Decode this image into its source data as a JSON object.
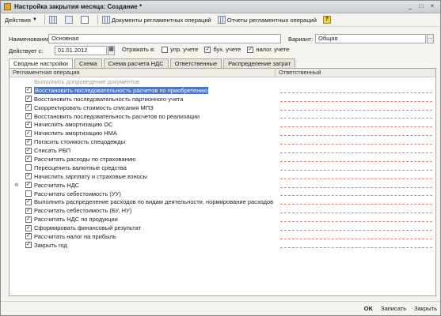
{
  "window": {
    "title": "Настройка закрытия месяца: Создание *",
    "controls": [
      "_",
      "□",
      "×"
    ]
  },
  "toolbar": {
    "actions_label": "Действия",
    "doc_reg_label": "Документы регламентных операций",
    "reports_label": "Отчеты регламентных операций"
  },
  "form": {
    "name_label": "Наименование:",
    "name_value": "Основная",
    "variant_label": "Вариант:",
    "variant_value": "Общая",
    "valid_from_label": "Действует с:",
    "valid_from_value": "01.01.2012",
    "reflect_label": "Отражать в:",
    "upr_label": "упр. учете",
    "upr_checked": false,
    "buh_label": "бух. учете",
    "buh_checked": true,
    "nal_label": "налог. учете",
    "nal_checked": true
  },
  "tabs": [
    {
      "label": "Сводные настройки",
      "active": true
    },
    {
      "label": "Схема",
      "active": false
    },
    {
      "label": "Схема расчета НДС",
      "active": false
    },
    {
      "label": "Ответственные",
      "active": false
    },
    {
      "label": "Распределение затрат",
      "active": false
    }
  ],
  "grid": {
    "col1": "Регламентная операция",
    "col2": "Ответственный",
    "rows": [
      {
        "label": "Выполнить допроведение документов",
        "checked": null,
        "style": "header"
      },
      {
        "label": "Восстановить последовательность расчетов по приобретению",
        "checked": true,
        "style": "selected"
      },
      {
        "label": "Восстановить последовательность партионного учета",
        "checked": true,
        "style": "normal"
      },
      {
        "label": "Скорректировать стоимость списания МПЗ",
        "checked": true,
        "style": "normal"
      },
      {
        "label": "Восстановить последовательность расчетов по реализации",
        "checked": true,
        "style": "normal"
      },
      {
        "label": "Начислить амортизацию ОС",
        "checked": true,
        "style": "normal"
      },
      {
        "label": "Начислить амортизацию НМА",
        "checked": true,
        "style": "normal"
      },
      {
        "label": "Погасить стоимость спецодежды",
        "checked": true,
        "style": "normal"
      },
      {
        "label": "Списать РБП",
        "checked": true,
        "style": "normal"
      },
      {
        "label": "Рассчитать расходы по страхованию",
        "checked": true,
        "style": "normal"
      },
      {
        "label": "Переоценить валютные средства",
        "checked": false,
        "style": "normal"
      },
      {
        "label": "Начислить зарплату и страховые взносы",
        "checked": true,
        "style": "normal"
      },
      {
        "label": "Рассчитать НДС",
        "checked": true,
        "style": "group"
      },
      {
        "label": "Рассчитать себестоимость (УУ)",
        "checked": false,
        "style": "normal"
      },
      {
        "label": "Выполнить распределение расходов по видам деятельности, нормирование расходов",
        "checked": true,
        "style": "normal"
      },
      {
        "label": "Рассчитать себестоимость (БУ, НУ)",
        "checked": true,
        "style": "normal"
      },
      {
        "label": "Рассчитать НДС по продукции",
        "checked": true,
        "style": "normal"
      },
      {
        "label": "Сформировать финансовый результат",
        "checked": true,
        "style": "normal"
      },
      {
        "label": "Рассчитать налог на прибыль",
        "checked": true,
        "style": "normal"
      },
      {
        "label": "Закрыть год",
        "checked": true,
        "style": "normal"
      }
    ]
  },
  "statusbar": {
    "ok_label": "OK",
    "save_label": "Записать",
    "close_label": "Закрыть"
  }
}
